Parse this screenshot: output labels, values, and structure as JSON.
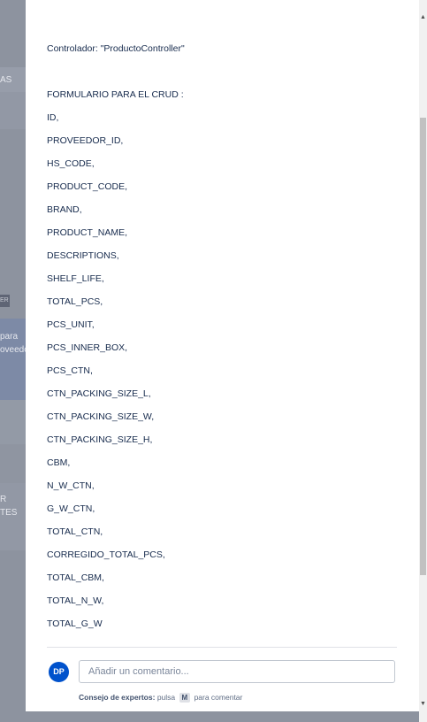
{
  "background": {
    "fragments": [
      "AS",
      "para",
      "oveedo",
      "R",
      "TES"
    ],
    "tag": "ER"
  },
  "description": {
    "controller_line": "Controlador: \"ProductoController\"",
    "form_heading": "FORMULARIO PARA EL CRUD :",
    "fields": [
      "ID,",
      "PROVEEDOR_ID,",
      "HS_CODE,",
      "PRODUCT_CODE,",
      "BRAND,",
      "PRODUCT_NAME,",
      "DESCRIPTIONS,",
      "SHELF_LIFE,",
      "TOTAL_PCS,",
      "PCS_UNIT,",
      "PCS_INNER_BOX,",
      "PCS_CTN,",
      "CTN_PACKING_SIZE_L,",
      "CTN_PACKING_SIZE_W,",
      "CTN_PACKING_SIZE_H,",
      "CBM,",
      "N_W_CTN,",
      "G_W_CTN,",
      "TOTAL_CTN,",
      "CORREGIDO_TOTAL_PCS,",
      "TOTAL_CBM,",
      "TOTAL_N_W,",
      "TOTAL_G_W"
    ]
  },
  "comment": {
    "avatar_initials": "DP",
    "placeholder": "Añadir un comentario...",
    "tip_bold": "Consejo de expertos:",
    "tip_pre": "pulsa",
    "tip_key": "M",
    "tip_post": "para comentar"
  },
  "colors": {
    "accent": "#0052cc",
    "text": "#172b4d",
    "overlay": "#8d939f"
  },
  "icons": {
    "scroll_up": "triangle-up-icon",
    "scroll_down": "triangle-down-icon"
  }
}
